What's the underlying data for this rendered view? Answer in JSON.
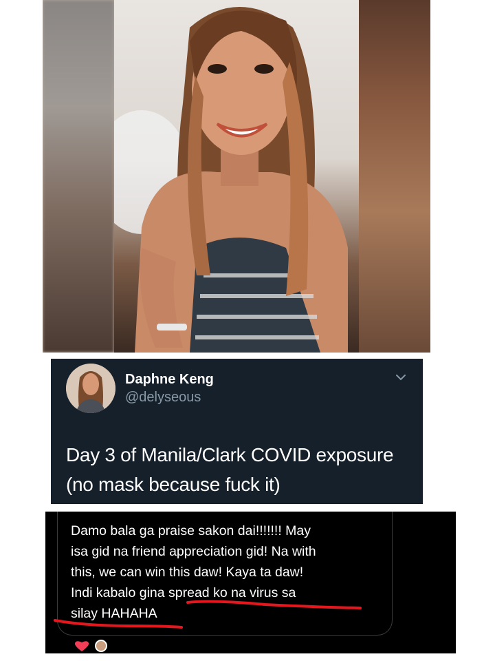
{
  "tweet": {
    "name": "Daphne Keng",
    "handle": "@delyseous",
    "text": "Day 3 of Manila/Clark COVID exposure (no mask because fuck it)"
  },
  "comment": {
    "lines": [
      "Damo bala ga praise sakon dai!!!!!!! May",
      "isa gid na friend appreciation gid! Na with",
      "this, we can win this daw! Kaya ta daw!",
      "Indi kabalo gina spread ko na virus sa",
      "silay HAHAHA"
    ]
  },
  "colors": {
    "tweet_bg": "#15202b",
    "tweet_handle": "#8899a6",
    "comment_bg": "#000000",
    "underline": "#e3171e",
    "heart": "#f33e58"
  },
  "icons": {
    "tweet_menu": "chevron-down-icon",
    "reaction": "heart-icon"
  }
}
